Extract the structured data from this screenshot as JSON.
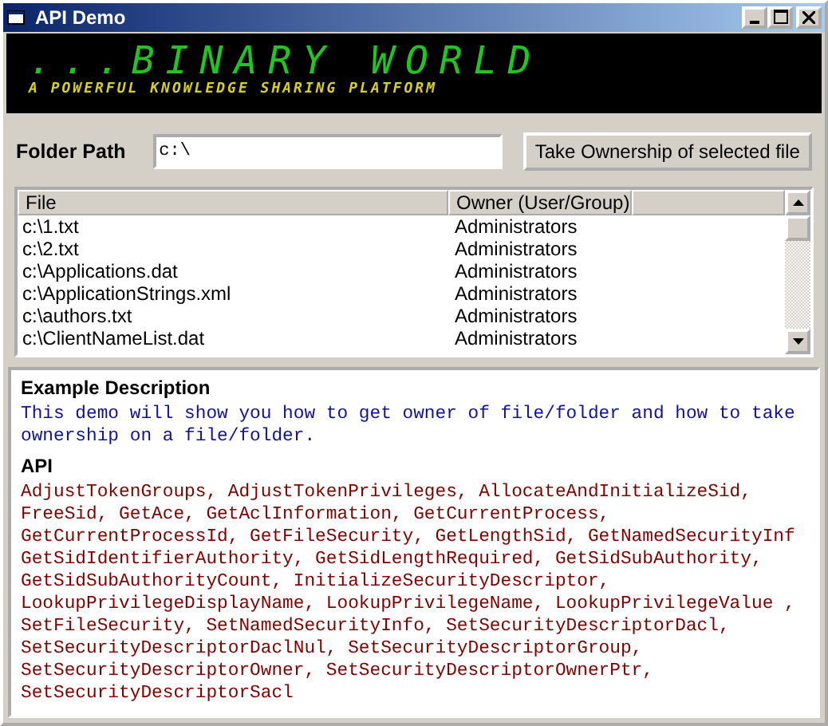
{
  "window": {
    "title": "API Demo"
  },
  "banner": {
    "title": "...BINARY WORLD",
    "subtitle": "A POWERFUL KNOWLEDGE SHARING PLATFORM"
  },
  "folder_path": {
    "label": "Folder Path",
    "value": "c:\\"
  },
  "take_ownership_button": "Take Ownership of selected file",
  "table": {
    "columns": [
      "File",
      "Owner (User/Group)"
    ],
    "rows": [
      {
        "file": "c:\\1.txt",
        "owner": "Administrators",
        "selected": false
      },
      {
        "file": "c:\\2.txt",
        "owner": "Administrators",
        "selected": false
      },
      {
        "file": "c:\\Applications.dat",
        "owner": "Administrators",
        "selected": false
      },
      {
        "file": "c:\\ApplicationStrings.xml",
        "owner": "Administrators",
        "selected": false
      },
      {
        "file": "c:\\authors.txt",
        "owner": "Administrators",
        "selected": false
      },
      {
        "file": "c:\\ClientNameList.dat",
        "owner": "Administrators",
        "selected": false
      }
    ]
  },
  "description": {
    "heading": "Example Description",
    "lines": [
      "This demo will show you how to get owner of file/folder and how to take",
      "ownership on a file/folder."
    ],
    "api_heading": "API",
    "api_lines": [
      "AdjustTokenGroups, AdjustTokenPrivileges, AllocateAndInitializeSid,",
      "FreeSid, GetAce, GetAclInformation, GetCurrentProcess,",
      "GetCurrentProcessId, GetFileSecurity, GetLengthSid, GetNamedSecurityInf",
      "GetSidIdentifierAuthority, GetSidLengthRequired, GetSidSubAuthority,",
      "GetSidSubAuthorityCount, InitializeSecurityDescriptor,",
      "LookupPrivilegeDisplayName, LookupPrivilegeName, LookupPrivilegeValue ,",
      "SetFileSecurity, SetNamedSecurityInfo, SetSecurityDescriptorDacl,",
      "SetSecurityDescriptorDaclNul, SetSecurityDescriptorGroup,",
      "SetSecurityDescriptorOwner, SetSecurityDescriptorOwnerPtr,",
      "SetSecurityDescriptorSacl"
    ]
  }
}
